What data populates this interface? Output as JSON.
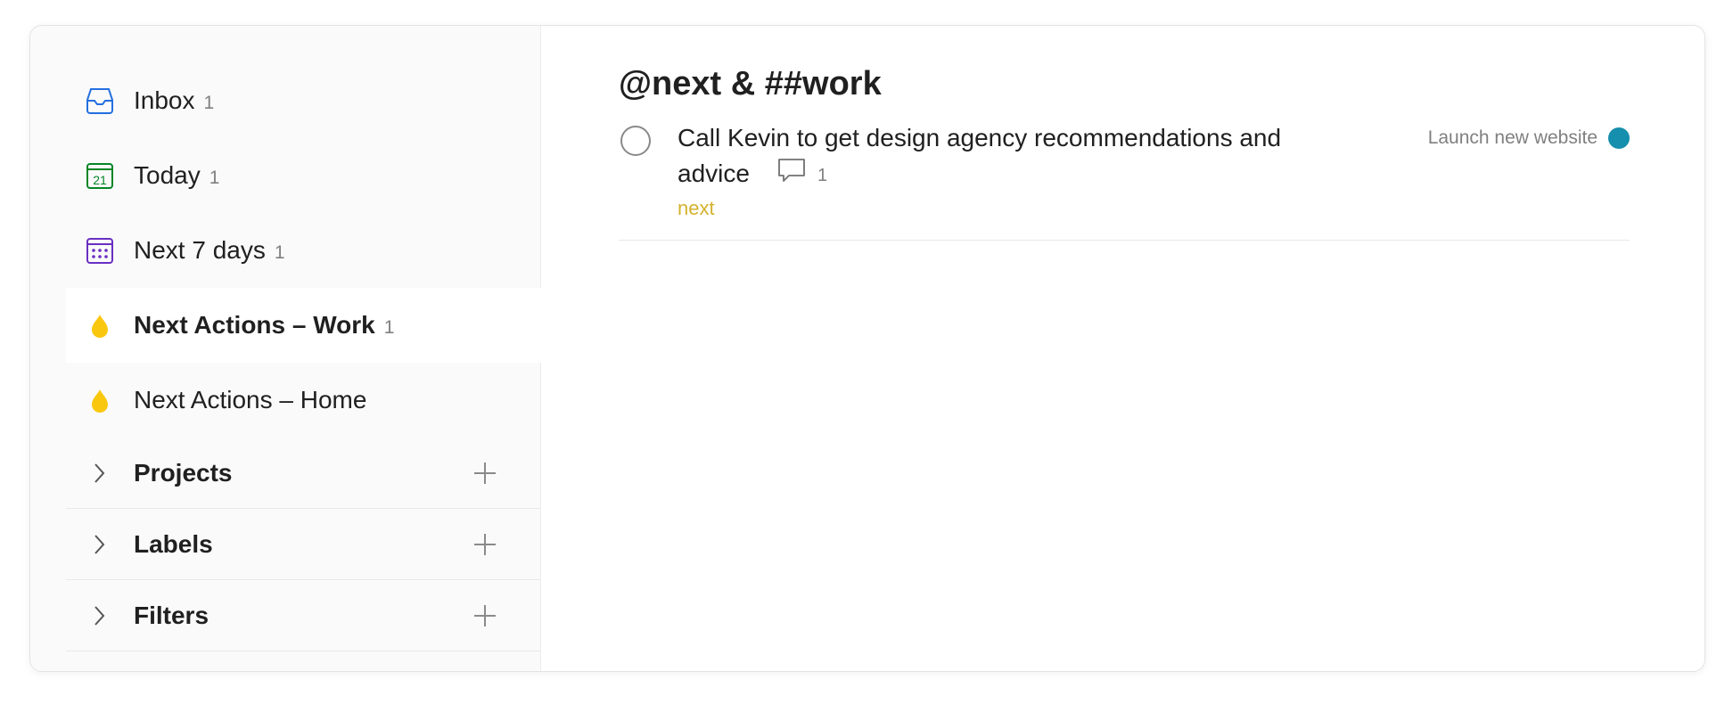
{
  "colors": {
    "inbox_icon": "#246fe0",
    "today_icon": "#058527",
    "next7_icon": "#692fc2",
    "filter_drop": "#f9c80e",
    "label_text": "#d4b22e",
    "project_dot": "#158fad"
  },
  "sidebar": {
    "items": [
      {
        "label": "Inbox",
        "count": "1",
        "icon": "inbox-icon"
      },
      {
        "label": "Today",
        "count": "1",
        "icon": "calendar-today-icon",
        "day": "21"
      },
      {
        "label": "Next 7 days",
        "count": "1",
        "icon": "calendar-week-icon"
      },
      {
        "label": "Next Actions – Work",
        "count": "1",
        "icon": "drop-icon",
        "active": true
      },
      {
        "label": "Next Actions – Home",
        "count": "",
        "icon": "drop-icon"
      }
    ],
    "sections": [
      {
        "label": "Projects"
      },
      {
        "label": "Labels"
      },
      {
        "label": "Filters"
      }
    ]
  },
  "main": {
    "title": "@next & ##work",
    "tasks": [
      {
        "content": "Call Kevin to get design agency recommendations and advice",
        "comment_count": "1",
        "label": "next",
        "project": "Launch new website"
      }
    ]
  }
}
